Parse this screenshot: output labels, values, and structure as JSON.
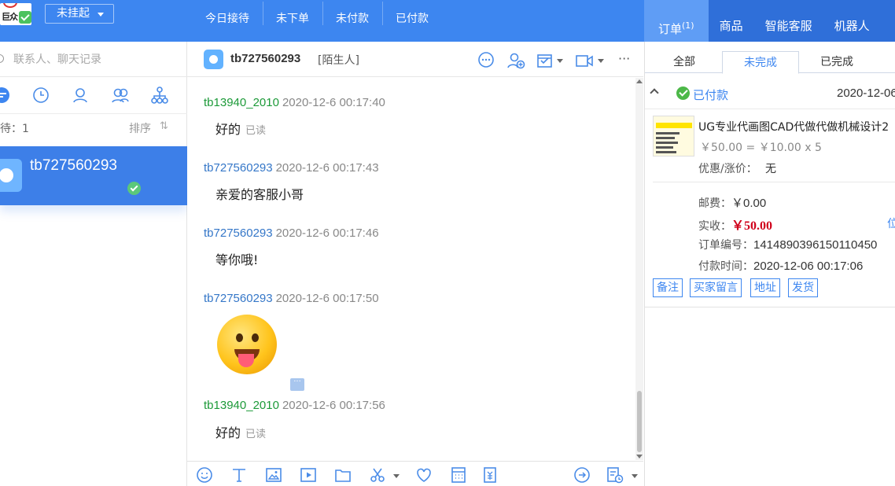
{
  "colors": {
    "primary": "#3d86f0",
    "self_sender": "#1d9a39",
    "other_sender": "#3577c8",
    "price_red": "#d0021b"
  },
  "topbar": {
    "logo_text": "巨众",
    "status": "未挂起",
    "tabs": [
      "今日接待",
      "未下单",
      "未付款",
      "已付款"
    ],
    "right_nav": {
      "orders": "订单",
      "orders_count": "(1)",
      "goods": "商品",
      "ai_service": "智能客服",
      "robot": "机器人"
    }
  },
  "sidebar": {
    "search_placeholder": "联系人、聊天记录",
    "waiting_label": "待：1",
    "sort_label": "排序",
    "sort_icon": "⇅",
    "icons": [
      "chat-list-icon",
      "clock-icon",
      "person-icon",
      "group-icon",
      "org-icon"
    ],
    "contact": {
      "name": "tb727560293"
    }
  },
  "chat": {
    "name": "tb727560293",
    "tag": "[陌生人]",
    "more": "···",
    "messages": [
      {
        "sender": "tb13940_2010",
        "time": "2020-12-6 00:17:40",
        "text": "好的",
        "read": "已读"
      },
      {
        "sender": "tb727560293",
        "time": "2020-12-6 00:17:43",
        "text": "亲爱的客服小哥"
      },
      {
        "sender": "tb727560293",
        "time": "2020-12-6 00:17:46",
        "text": "等你哦!"
      },
      {
        "sender": "tb727560293",
        "time": "2020-12-6 00:17:50",
        "emoji": "tongue-out-face"
      },
      {
        "sender": "tb13940_2010",
        "time": "2020-12-6 00:17:56",
        "text": "好的",
        "read": "已读"
      }
    ],
    "more_badge": "···"
  },
  "orders": {
    "tabs": [
      "全部",
      "未完成",
      "已完成"
    ],
    "status": "已付款",
    "date": "2020-12-06",
    "product_title": "UG专业代画图CAD代做代做机械设计2",
    "price_line": "￥50.00 = ￥10.00 x 5",
    "discount_label": "优惠/涨价：",
    "discount_value": "无",
    "shipping_label": "邮费：",
    "shipping_value": "￥0.00",
    "received_label": "实收：",
    "received_value": "￥50.00",
    "order_no_label": "订单编号：",
    "order_no_value": "1414890396150110450",
    "pay_time_label": "付款时间：",
    "pay_time_value": "2020-12-06 00:17:06",
    "truncated_link": "位",
    "actions": [
      "备注",
      "买家留言",
      "地址",
      "发货"
    ]
  }
}
